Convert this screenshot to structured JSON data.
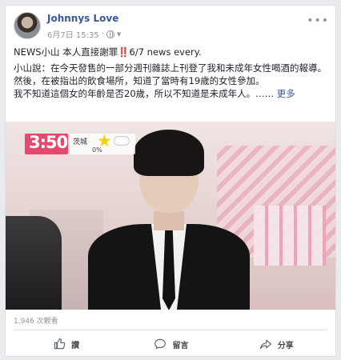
{
  "post": {
    "page_name": "Johnnys Love",
    "time": "6月7日 15:35",
    "privacy_icon": "globe-icon",
    "title_line": "NEWS小山 本人直接謝罪‼️6/7 news every.",
    "paragraphs": [
      "小山說：在今天發售的一部分週刊雜誌上刊登了我和未成年女性喝酒的報導。",
      "然後，在被指出的飲食場所，知道了當時有19歲的女性參加。",
      "我不知道這個女的年齡是否20歲，所以不知道是未成年人。……"
    ],
    "see_more": "更多",
    "views": "1,946 次觀看"
  },
  "video_overlay": {
    "clock": "3:50",
    "city": "茨城",
    "percent": "0%"
  },
  "actions": [
    {
      "label": "讚",
      "icon": "like-icon"
    },
    {
      "label": "留言",
      "icon": "comment-icon"
    },
    {
      "label": "分享",
      "icon": "share-icon"
    }
  ],
  "colors": {
    "link": "#365899",
    "text": "#1d2129",
    "secondary": "#90949c",
    "accent": "#e5486c"
  }
}
